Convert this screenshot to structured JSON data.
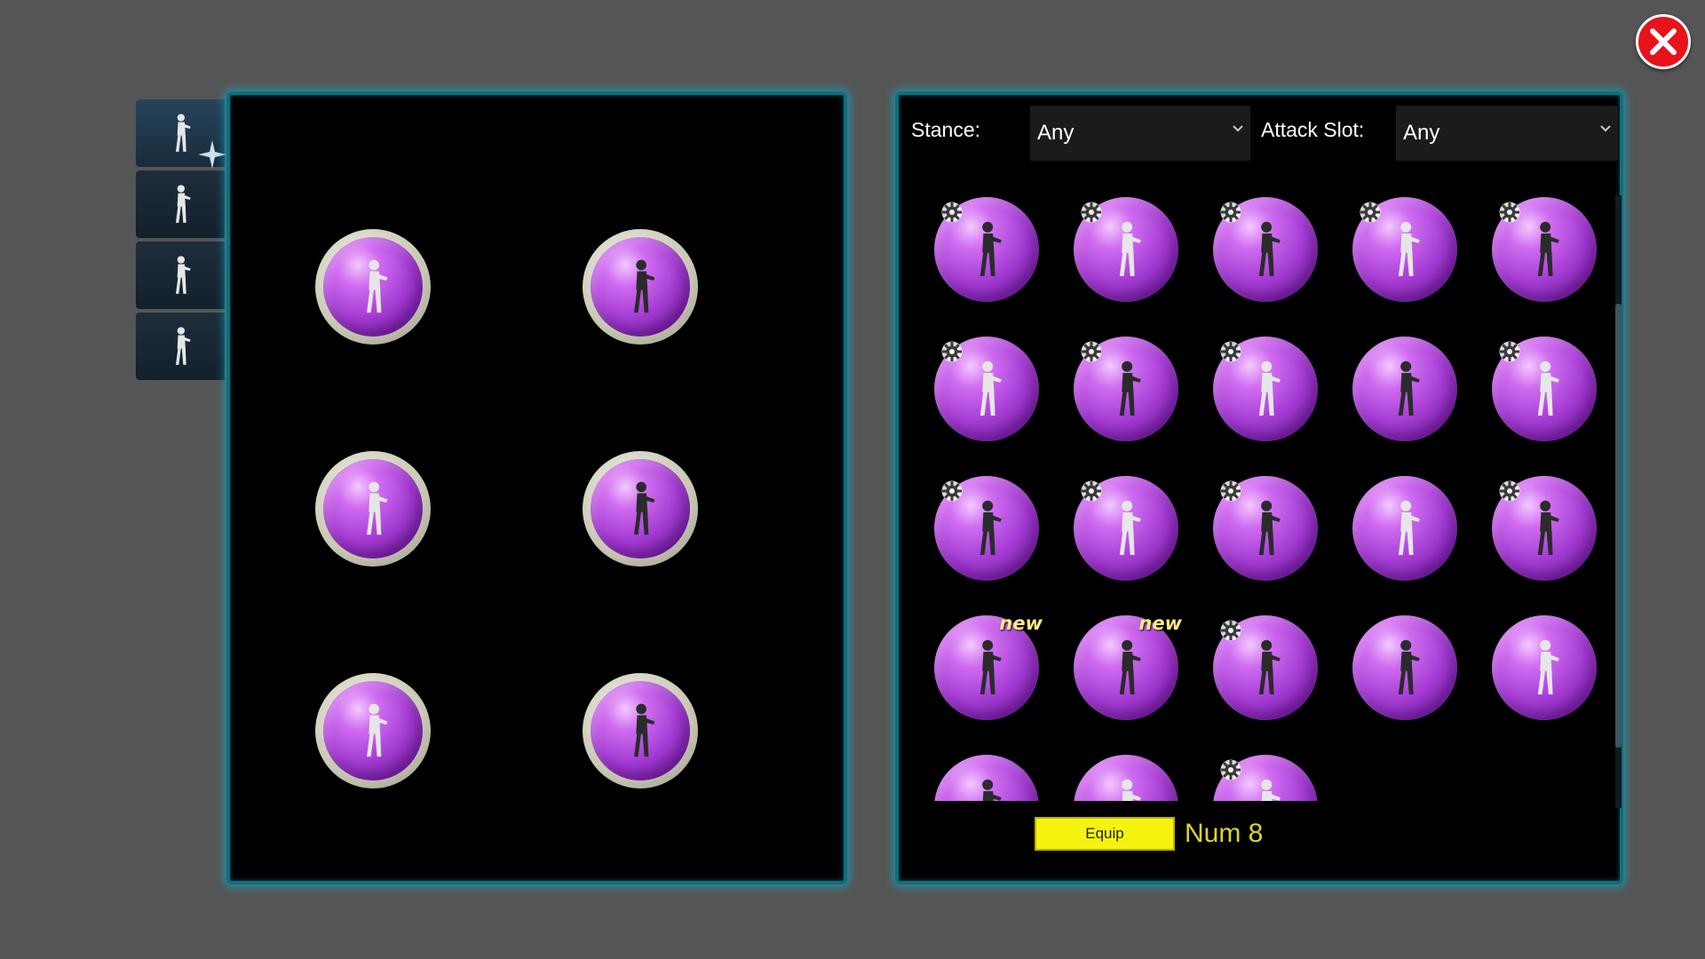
{
  "close": {
    "icon": "close-x-icon"
  },
  "stance_tabs": [
    {
      "icon": "fighter-stance-1-icon",
      "active": true
    },
    {
      "icon": "fighter-stance-2-icon",
      "active": false
    },
    {
      "icon": "fighter-stance-3-icon",
      "active": false
    },
    {
      "icon": "fighter-stance-4-icon",
      "active": false
    }
  ],
  "equipped_slots": [
    {
      "icon": "stand-pose-icon",
      "figure": "light"
    },
    {
      "icon": "punch-pose-icon",
      "figure": "dark"
    },
    {
      "icon": "high-kick-pose-icon",
      "figure": "light"
    },
    {
      "icon": "low-lunge-pose-icon",
      "figure": "dark"
    },
    {
      "icon": "side-kick-pose-icon",
      "figure": "light"
    },
    {
      "icon": "sweep-kick-pose-icon",
      "figure": "dark"
    }
  ],
  "filters": {
    "stance_label": "Stance:",
    "stance_value": "Any",
    "attack_slot_label": "Attack Slot:",
    "attack_slot_value": "Any"
  },
  "moves": [
    {
      "figure": "dark",
      "gear": true,
      "new": false
    },
    {
      "figure": "light",
      "gear": true,
      "new": false
    },
    {
      "figure": "dark",
      "gear": true,
      "new": false
    },
    {
      "figure": "light",
      "gear": true,
      "new": false
    },
    {
      "figure": "dark",
      "gear": true,
      "new": false
    },
    {
      "figure": "light",
      "gear": true,
      "new": false
    },
    {
      "figure": "dark",
      "gear": true,
      "new": false
    },
    {
      "figure": "light",
      "gear": true,
      "new": false
    },
    {
      "figure": "dark",
      "gear": false,
      "new": false
    },
    {
      "figure": "light",
      "gear": true,
      "new": false
    },
    {
      "figure": "dark",
      "gear": true,
      "new": false
    },
    {
      "figure": "light",
      "gear": true,
      "new": false
    },
    {
      "figure": "dark",
      "gear": true,
      "new": false
    },
    {
      "figure": "light",
      "gear": false,
      "new": false
    },
    {
      "figure": "dark",
      "gear": true,
      "new": false
    },
    {
      "figure": "dark",
      "gear": false,
      "new": true
    },
    {
      "figure": "dark",
      "gear": false,
      "new": true
    },
    {
      "figure": "dark",
      "gear": true,
      "new": false
    },
    {
      "figure": "dark",
      "gear": false,
      "new": false
    },
    {
      "figure": "light",
      "gear": false,
      "new": false
    },
    {
      "figure": "dark",
      "gear": false,
      "new": false
    },
    {
      "figure": "light",
      "gear": false,
      "new": false
    },
    {
      "figure": "light",
      "gear": true,
      "new": false
    }
  ],
  "new_label": "new",
  "equip_label": "Equip",
  "num_label": "Num 8"
}
